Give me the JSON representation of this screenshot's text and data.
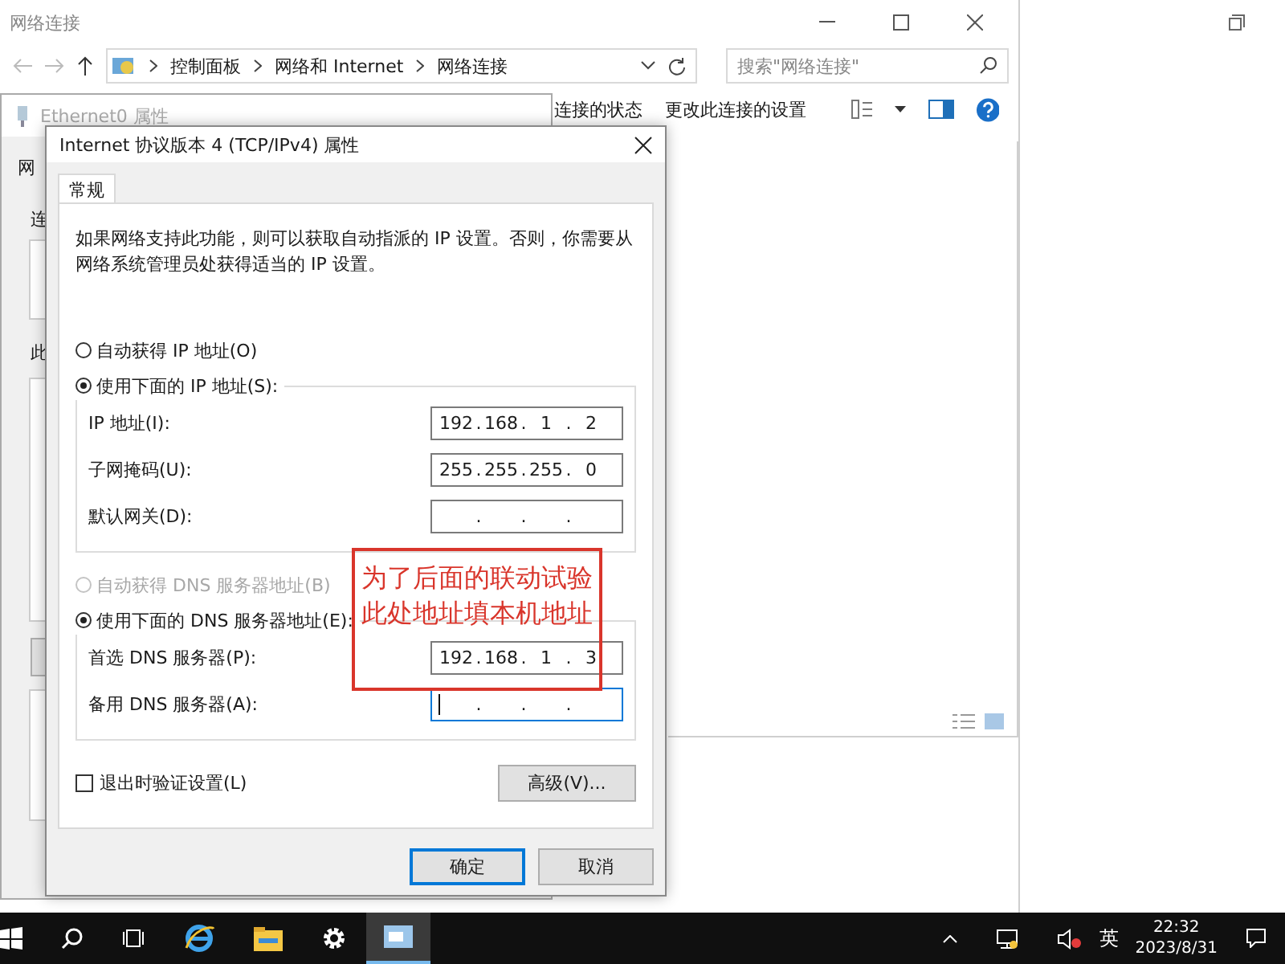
{
  "explorer": {
    "title": "网络连接",
    "breadcrumb": [
      "控制面板",
      "网络和 Internet",
      "网络连接"
    ],
    "search": {
      "placeholder": "搜索\"网络连接\""
    },
    "toolbar": [
      "连接的状态",
      "更改此连接的设置"
    ]
  },
  "background_dialog": {
    "title": "Ethernet0 属性",
    "tab": "网",
    "labels": [
      "连",
      "此"
    ]
  },
  "dialog": {
    "title": "Internet 协议版本 4 (TCP/IPv4) 属性",
    "tabs": [
      {
        "label": "常规",
        "selected": true
      }
    ],
    "description": "如果网络支持此功能，则可以获取自动指派的 IP 设置。否则，你需要从网络系统管理员处获得适当的 IP 设置。",
    "ip_options": [
      {
        "label": "自动获得 IP 地址(O)",
        "selected": false,
        "disabled": false
      },
      {
        "label": "使用下面的 IP 地址(S):",
        "selected": true,
        "disabled": false
      }
    ],
    "ip_fields": [
      {
        "label": "IP 地址(I):",
        "octets": [
          "192",
          "168",
          "1",
          "2"
        ],
        "focused": false
      },
      {
        "label": "子网掩码(U):",
        "octets": [
          "255",
          "255",
          "255",
          "0"
        ],
        "focused": false
      },
      {
        "label": "默认网关(D):",
        "focused": false
      }
    ],
    "dns_options": [
      {
        "label": "自动获得 DNS 服务器地址(B)",
        "selected": false,
        "disabled": true
      },
      {
        "label": "使用下面的 DNS 服务器地址(E):",
        "selected": true,
        "disabled": false
      }
    ],
    "dns_fields": [
      {
        "label": "首选 DNS 服务器(P):",
        "octets": [
          "192",
          "168",
          "1",
          "3"
        ],
        "focused": false
      },
      {
        "label": "备用 DNS 服务器(A):",
        "focused": true
      }
    ],
    "validate": {
      "label": "退出时验证设置(L)",
      "checked": false
    },
    "octet_separator": ".",
    "advanced_button": "高级(V)...",
    "buttons": [
      {
        "label": "确定",
        "default": true
      },
      {
        "label": "取消",
        "default": false
      }
    ]
  },
  "annotation": {
    "lines": [
      "为了后面的联动试验",
      "此处地址填本机地址"
    ]
  },
  "taskbar": {
    "language": "英",
    "time": "22:32",
    "date": "2023/8/31"
  }
}
